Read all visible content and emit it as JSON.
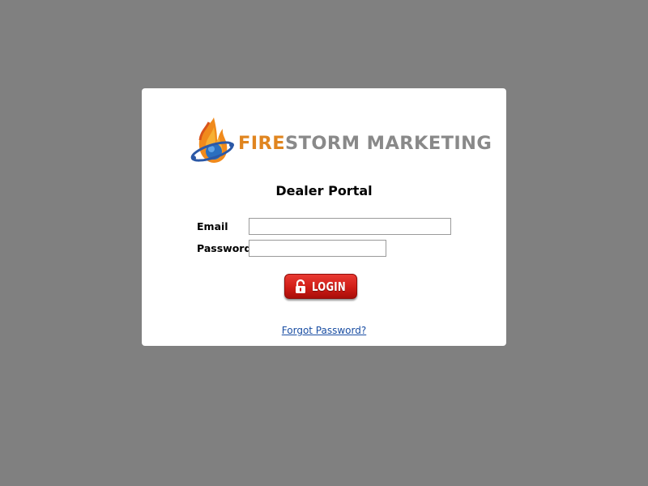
{
  "logo": {
    "text_fire": "FIRE",
    "text_rest": "STORM MARKETING",
    "icon": "flame-globe-logo"
  },
  "portal": {
    "title": "Dealer Portal"
  },
  "form": {
    "email_label": "Email",
    "email_value": "",
    "password_label": "Password",
    "password_value": "",
    "login_label": "LOGIN",
    "forgot_label": "Forgot Password?"
  },
  "colors": {
    "background": "#808080",
    "button_red": "#d01d16",
    "link_blue": "#1a4ea3",
    "logo_orange": "#e0851f",
    "logo_gray": "#898989"
  }
}
